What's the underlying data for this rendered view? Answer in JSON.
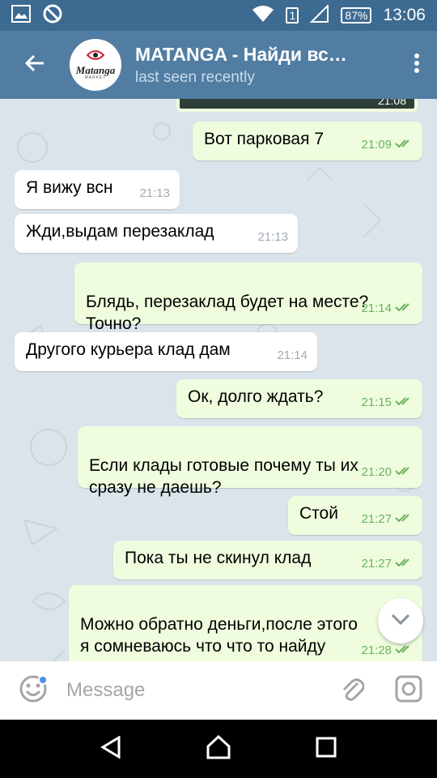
{
  "status_bar": {
    "battery": "87%",
    "time": "13:06",
    "sim": "1",
    "icons": [
      "image-icon",
      "blocked-icon",
      "wifi-icon",
      "sim-icon",
      "signal-icon",
      "battery-icon"
    ]
  },
  "header": {
    "title": "MATANGA - Найди вс…",
    "subtitle": "last seen recently",
    "avatar_logo": "Matanga",
    "avatar_sub": "MARKET",
    "icons": [
      "back-arrow-icon",
      "more-vert-icon"
    ]
  },
  "colors": {
    "header": "#517da2",
    "status_bar": "#3d6a91",
    "chat_bg": "#dae4ea",
    "outgoing": "#effdde",
    "incoming": "#ffffff",
    "check": "#6ab25f"
  },
  "media_stub": {
    "time": "21:08"
  },
  "messages": [
    {
      "dir": "out",
      "text": "Вот парковая 7",
      "time": "21:09"
    },
    {
      "dir": "in",
      "text": "Я вижу всн",
      "time": "21:13"
    },
    {
      "dir": "in",
      "text": "Жди,выдам перезаклад",
      "time": "21:13"
    },
    {
      "dir": "out",
      "text": "Блядь, перезаклад будет на месте?\nТочно?",
      "time": "21:14"
    },
    {
      "dir": "in",
      "text": "Другого курьера клад дам",
      "time": "21:14"
    },
    {
      "dir": "out",
      "text": "Ок, долго ждать?",
      "time": "21:15"
    },
    {
      "dir": "out",
      "text": "Если клады готовые почему ты их\nсразу не даешь?",
      "time": "21:20"
    },
    {
      "dir": "out",
      "text": "Стой",
      "time": "21:27"
    },
    {
      "dir": "out",
      "text": "Пока ты не скинул клад",
      "time": "21:27"
    },
    {
      "dir": "out",
      "text": "Можно обратно деньги,после этого\nя сомневаюсь что что то найду",
      "time": "21:28"
    }
  ],
  "input": {
    "placeholder": "Message"
  },
  "icons": [
    "emoji-icon",
    "attach-icon",
    "camera-icon",
    "chevron-down-icon",
    "nav-back-icon",
    "nav-home-icon",
    "nav-recents-icon"
  ]
}
